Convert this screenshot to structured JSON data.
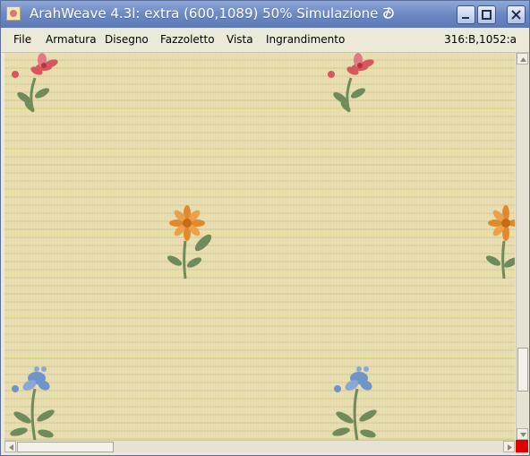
{
  "window": {
    "title": "ArahWeave 4.3l: extra (600,1089) 50% Simulazione 7",
    "icons": {
      "app": "arahweave-app-icon",
      "swirl": "swirl-icon",
      "minimize": "minimize-icon",
      "maximize": "maximize-icon",
      "close": "close-icon"
    }
  },
  "menubar": {
    "items": [
      "File",
      "Armatura",
      "Disegno",
      "Fazzoletto",
      "Vista",
      "Ingrandimento"
    ],
    "coords": "316:B,1052:a"
  },
  "canvas": {
    "motifs": [
      "red-flower-icon",
      "orange-flower-icon",
      "blue-flower-icon"
    ],
    "colors": {
      "background": "#e7dcae",
      "red": "#d7575c",
      "orange": "#e18a2c",
      "blue": "#6f94c8",
      "leaf": "#6f8b5a"
    }
  },
  "scrollbars": {
    "vertical_position": 0.78,
    "horizontal_position": 0.0,
    "corner_color": "#e00000"
  }
}
